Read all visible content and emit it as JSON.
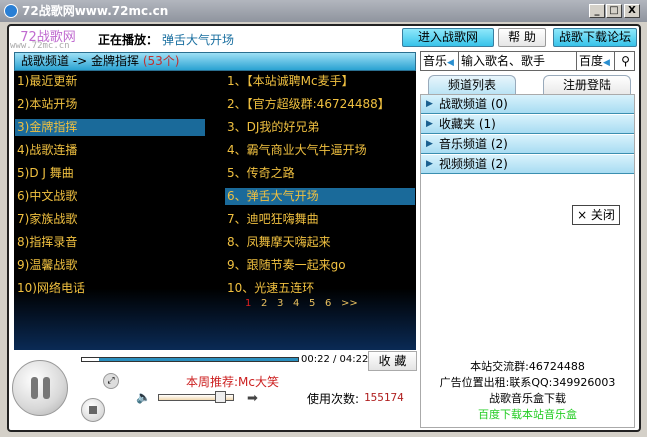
{
  "window": {
    "title": "72战歌网www.72mc.cn",
    "min": "_",
    "max": "□",
    "close": "X"
  },
  "logo": {
    "text": "72战歌网",
    "url": "www.72mc.cn"
  },
  "now_playing": {
    "label": "正在播放：",
    "song": "弹舌大气开场"
  },
  "top_buttons": [
    "进入战歌网",
    "帮 助",
    "战歌下载论坛"
  ],
  "list_header": {
    "path": "战歌频道 -> 金牌指挥",
    "count": "(53个)"
  },
  "categories": [
    "1)最近更新",
    "2)本站开场",
    "3)金牌指挥",
    "4)战歌连播",
    "5)D J 舞曲",
    "6)中文战歌",
    "7)家族战歌",
    "8)指挥录音",
    "9)温馨战歌",
    "10)网络电话"
  ],
  "selected_category": 2,
  "songs": [
    "1、【本站诚聘Mc麦手】",
    "2、【官方超级群:46724488】",
    "3、DJ我的好兄弟",
    "4、霸气商业大气牛逼开场",
    "5、传奇之路",
    "6、弹舌大气开场",
    "7、迪吧狂嗨舞曲",
    "8、凤舞摩天嗨起来",
    "9、跟随节奏一起来go",
    "10、光速五连环"
  ],
  "selected_song": 5,
  "pages": [
    "1",
    "2",
    "3",
    "4",
    "5",
    "6",
    ">>"
  ],
  "search": {
    "type": "音乐",
    "placeholder": "输入歌名、歌手",
    "engine": "百度"
  },
  "tabs": [
    "频道列表",
    "注册登陆"
  ],
  "channels": [
    "战歌频道 (0)",
    "收藏夹 (1)",
    "音乐频道 (2)",
    "视频频道 (2)"
  ],
  "close_label": "× 关闭",
  "player": {
    "time": "00:22 / 04:22",
    "progress": 0.08,
    "volume": 0.9,
    "fav": "收 藏",
    "recommend": "本周推荐:Mc大笑",
    "usage_label": "使用次数:",
    "usage_count": "155174"
  },
  "info": [
    "本站交流群:46724488",
    "广告位置出租:联系QQ:349926003",
    "战歌音乐盒下载",
    "百度下载本站音乐盒"
  ],
  "colors": {
    "accent": "#1a6a9a",
    "list_text": "#f0c040",
    "link_green": "#22cc22"
  }
}
